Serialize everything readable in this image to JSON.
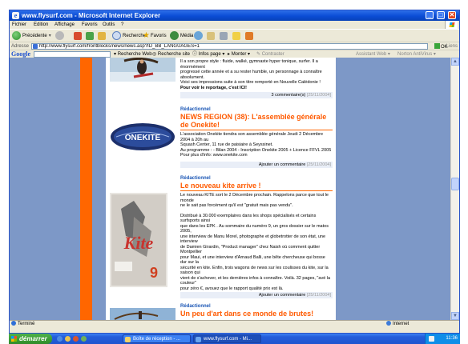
{
  "window": {
    "title": "www.flysurf.com - Microsoft Internet Explorer",
    "controls": {
      "minimize": "_",
      "maximize": "□",
      "close": "✕"
    }
  },
  "menubar": {
    "items": [
      {
        "label": "Fichier"
      },
      {
        "label": "Edition"
      },
      {
        "label": "Affichage"
      },
      {
        "label": "Favoris"
      },
      {
        "label": "Outils"
      },
      {
        "label": "?"
      }
    ]
  },
  "toolbar": {
    "back_label": "Précédente",
    "search_label": "Rechercher",
    "favorites_label": "Favoris",
    "media_label": "Média"
  },
  "address": {
    "label": "Adresse",
    "url": "http://www.flysurf.com/frontblocks/news/news.asp?ID_BB_LANGUAGES=1",
    "go_label": "OK",
    "links_label": "Liens"
  },
  "googlebar": {
    "logo": "Google",
    "search_web": "Recherche Web",
    "search_site": "Recherche site",
    "page_info": "Infos page",
    "up": "Monter",
    "highlight": "Contraster",
    "popup": "Assistant Web",
    "antivirus": "Norton AntiVirus"
  },
  "articles": [
    {
      "category": "",
      "headline": "",
      "body_html": "",
      "text_lines": [
        "Il a son propre style : fluide, walké, gymnaste hyper tonique, surfer. Il a énormément",
        "progressé cette année et a su rester humble, un personnage à connaître absolument.",
        "Voici ses impressions suite à son titre remporté en Nouvelle Calédonie !"
      ],
      "bold_line": "Pour voir le reportage, c'est ICI!",
      "footer_comment": "3 commentaire(s)",
      "footer_date": "[25/11/2004]"
    },
    {
      "category": "Rédactionnel",
      "headline": "NEWS REGION (38): L'assemblée générale de Onekite!",
      "text_lines": [
        "L'association Onekite tiendra son assemblée générale Jeudi 2 Décembre 2004 à 20h au",
        "Squash Center, 11 rue de paisiaire à Seyssinet.",
        "Au programme : - Bilan 2004 - Inscription Onekite 2005 + Licence FFVL 2005",
        "Pour plus d'info: www.onekite.com"
      ],
      "footer_comment": "Ajouter un commentaire",
      "footer_date": "[25/11/2004]",
      "logo_text": "ONEKITE"
    },
    {
      "category": "Rédactionnel",
      "headline": "Le nouveau kite arrive !",
      "text_lines": [
        "Le nouveau KITE sort le 2 Décembre prochain. Rappelons parce que tout le monde",
        "ne le sait pas forcément qu'il est \"gratuit mais pas vendu\".",
        "",
        "Distribué à 30.000 exemplaires dans les shops spécialisés et certains surfsports ainsi",
        "que dans les EPK . Au sommaire du numéro 9, un gros dossier sur le matos 2005,",
        "une interview de Manu Morel, photographe et globetrotter de son état, une interview",
        "de Damien Girardin, \"Product manager\" chez Naish où comment quitter Montpellier",
        "pour Maui, et une interview d'Arnaud Balli, une bête chercheuse qui bosse dur sur la",
        "sécurité en kite. Enfin, trois wagons de news sur les coulisses du kite, sur la saison qui",
        "vient de s'achever, et les dernières infos à connaître. Voilà. 32 pages, \"avé la couleur\"",
        "pour zéro €, avouez que le rapport qualité prix est là."
      ],
      "footer_comment": "Ajouter un commentaire",
      "footer_date": "[25/11/2004]",
      "cover_title": "Kite",
      "cover_number": "9"
    },
    {
      "category": "Rédactionnel",
      "headline": "Un peu d'art dans ce monde de brutes!"
    }
  ],
  "statusbar": {
    "left": "Terminé",
    "zone": "Internet"
  },
  "taskbar": {
    "start": "démarrer",
    "tasks": [
      {
        "label": "Boîte de réception - ..."
      },
      {
        "label": "www.flysurf.com - Mi..."
      }
    ],
    "clock": "11:36"
  },
  "colors": {
    "page_bg": "#7d98c7",
    "orange": "#ff6600",
    "headline": "#ff5a00",
    "category_blue": "#1a56b5"
  }
}
